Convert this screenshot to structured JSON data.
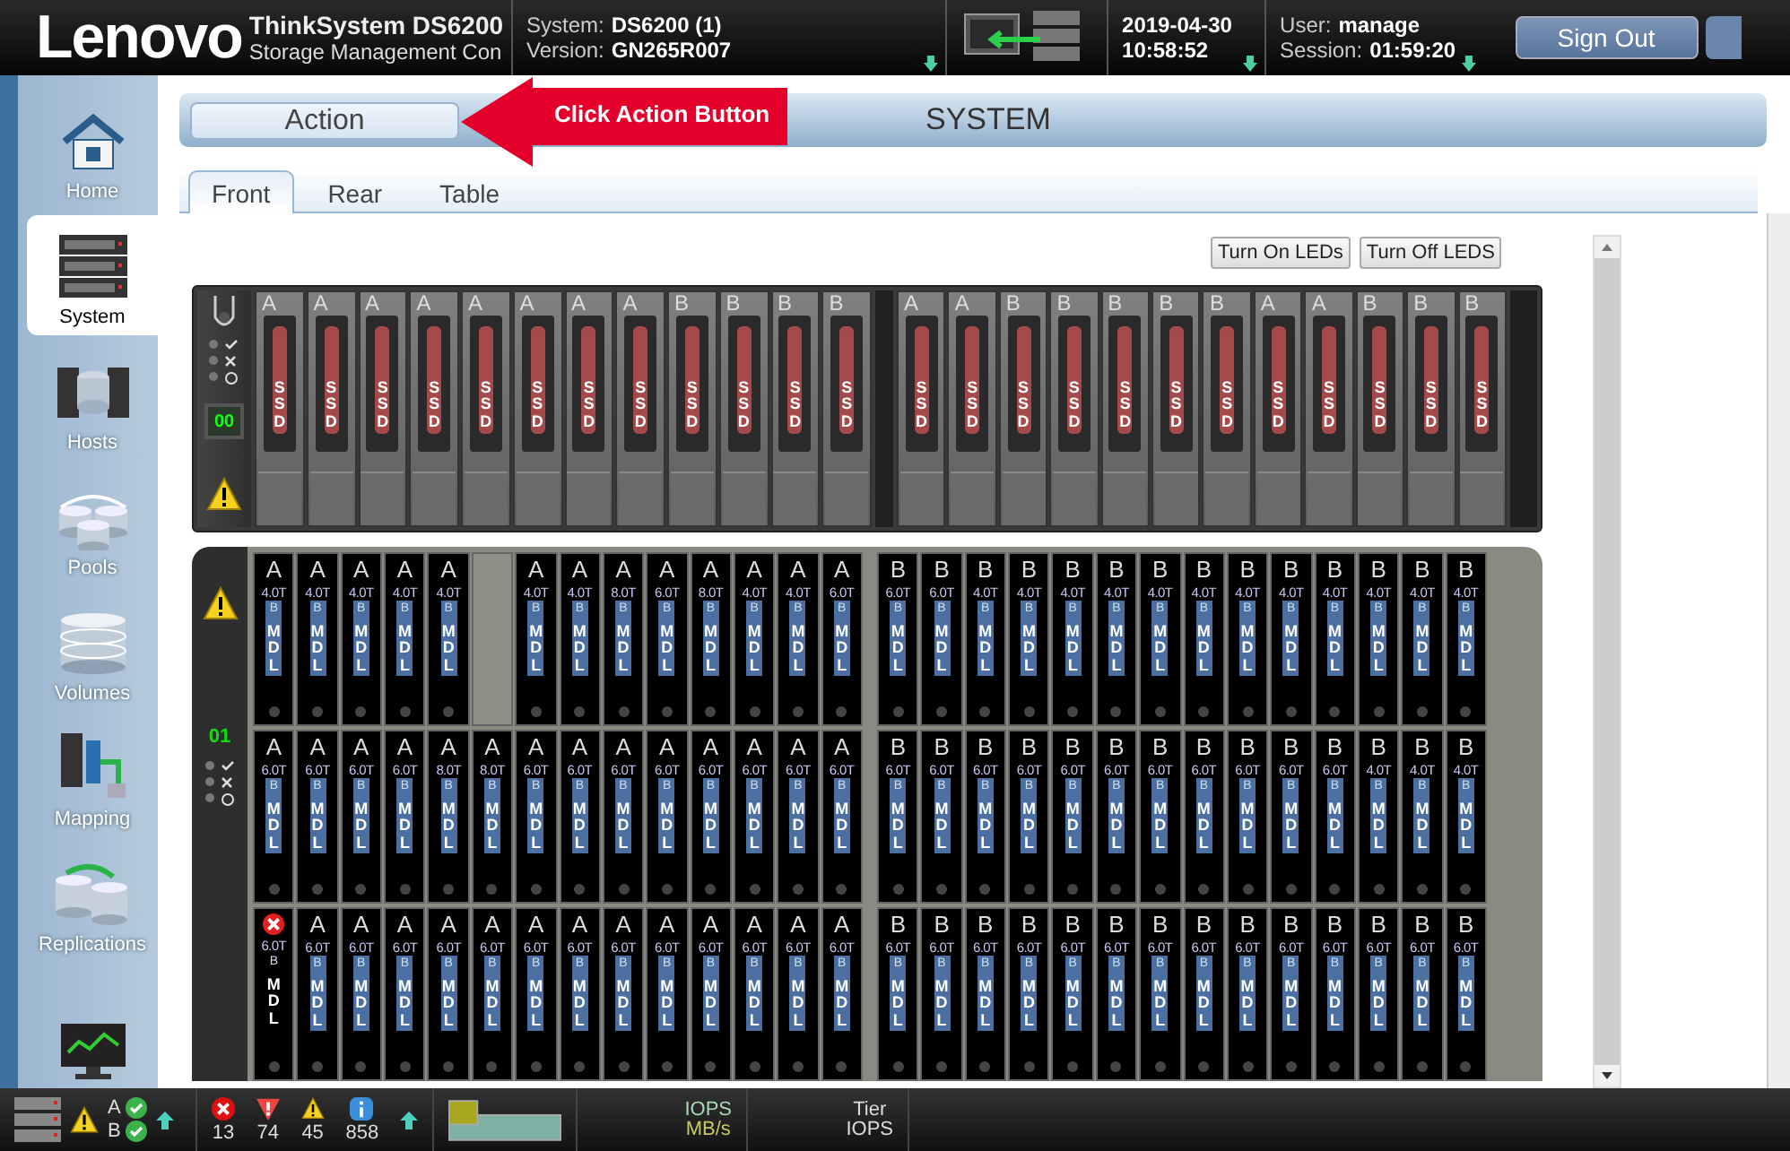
{
  "header": {
    "logo": "Lenovo",
    "product": "ThinkSystem DS6200",
    "subtitle": "Storage Management Con",
    "system_label": "System:",
    "system": "DS6200 (1)",
    "version_label": "Version:",
    "version": "GN265R007",
    "date": "2019-04-30",
    "time": "10:58:52",
    "user_label": "User:",
    "user": "manage",
    "session_label": "Session:",
    "session": "01:59:20",
    "sign_out": "Sign Out"
  },
  "sidebar": {
    "items": [
      {
        "label": "Home",
        "selected": false
      },
      {
        "label": "System",
        "selected": true
      },
      {
        "label": "Hosts",
        "selected": false
      },
      {
        "label": "Pools",
        "selected": false
      },
      {
        "label": "Volumes",
        "selected": false
      },
      {
        "label": "Mapping",
        "selected": false
      },
      {
        "label": "Replications",
        "selected": false
      }
    ]
  },
  "action_bar": {
    "button": "Action",
    "title": "SYSTEM",
    "callout": "Click Action Button"
  },
  "tabs": [
    {
      "label": "Front",
      "selected": true
    },
    {
      "label": "Rear",
      "selected": false
    },
    {
      "label": "Table",
      "selected": false
    }
  ],
  "led_buttons": [
    "Turn On LEDs",
    "Turn Off LEDS"
  ],
  "front_enclosure": {
    "display": "00",
    "left": [
      {
        "controller": "A",
        "type": "SSD"
      },
      {
        "controller": "A",
        "type": "SSD"
      },
      {
        "controller": "A",
        "type": "SSD"
      },
      {
        "controller": "A",
        "type": "SSD"
      },
      {
        "controller": "A",
        "type": "SSD"
      },
      {
        "controller": "A",
        "type": "SSD"
      },
      {
        "controller": "A",
        "type": "SSD"
      },
      {
        "controller": "A",
        "type": "SSD"
      },
      {
        "controller": "B",
        "type": "SSD"
      },
      {
        "controller": "B",
        "type": "SSD"
      },
      {
        "controller": "B",
        "type": "SSD"
      },
      {
        "controller": "B",
        "type": "SSD"
      }
    ],
    "right": [
      {
        "controller": "A",
        "type": "SSD"
      },
      {
        "controller": "A",
        "type": "SSD"
      },
      {
        "controller": "B",
        "type": "SSD"
      },
      {
        "controller": "B",
        "type": "SSD"
      },
      {
        "controller": "B",
        "type": "SSD"
      },
      {
        "controller": "B",
        "type": "SSD"
      },
      {
        "controller": "B",
        "type": "SSD"
      },
      {
        "controller": "A",
        "type": "SSD"
      },
      {
        "controller": "A",
        "type": "SSD"
      },
      {
        "controller": "B",
        "type": "SSD"
      },
      {
        "controller": "B",
        "type": "SSD"
      },
      {
        "controller": "B",
        "type": "SSD"
      }
    ]
  },
  "drive_enclosure": {
    "display": "01",
    "rows": [
      {
        "left": [
          {
            "kind": "drive",
            "controller": "A",
            "capacity": "4.0T",
            "tier": "B",
            "type": "MDL"
          },
          {
            "kind": "drive",
            "controller": "A",
            "capacity": "4.0T",
            "tier": "B",
            "type": "MDL"
          },
          {
            "kind": "drive",
            "controller": "A",
            "capacity": "4.0T",
            "tier": "B",
            "type": "MDL"
          },
          {
            "kind": "drive",
            "controller": "A",
            "capacity": "4.0T",
            "tier": "B",
            "type": "MDL"
          },
          {
            "kind": "drive",
            "controller": "A",
            "capacity": "4.0T",
            "tier": "B",
            "type": "MDL"
          },
          {
            "kind": "empty"
          },
          {
            "kind": "drive",
            "controller": "A",
            "capacity": "4.0T",
            "tier": "B",
            "type": "MDL"
          },
          {
            "kind": "drive",
            "controller": "A",
            "capacity": "4.0T",
            "tier": "B",
            "type": "MDL"
          },
          {
            "kind": "drive",
            "controller": "A",
            "capacity": "8.0T",
            "tier": "B",
            "type": "MDL"
          },
          {
            "kind": "drive",
            "controller": "A",
            "capacity": "6.0T",
            "tier": "B",
            "type": "MDL"
          },
          {
            "kind": "drive",
            "controller": "A",
            "capacity": "8.0T",
            "tier": "B",
            "type": "MDL"
          },
          {
            "kind": "drive",
            "controller": "A",
            "capacity": "4.0T",
            "tier": "B",
            "type": "MDL"
          },
          {
            "kind": "drive",
            "controller": "A",
            "capacity": "4.0T",
            "tier": "B",
            "type": "MDL"
          },
          {
            "kind": "drive",
            "controller": "A",
            "capacity": "6.0T",
            "tier": "B",
            "type": "MDL"
          }
        ],
        "right": [
          {
            "kind": "drive",
            "controller": "B",
            "capacity": "6.0T",
            "tier": "B",
            "type": "MDL"
          },
          {
            "kind": "drive",
            "controller": "B",
            "capacity": "6.0T",
            "tier": "B",
            "type": "MDL"
          },
          {
            "kind": "drive",
            "controller": "B",
            "capacity": "4.0T",
            "tier": "B",
            "type": "MDL"
          },
          {
            "kind": "drive",
            "controller": "B",
            "capacity": "4.0T",
            "tier": "B",
            "type": "MDL"
          },
          {
            "kind": "drive",
            "controller": "B",
            "capacity": "4.0T",
            "tier": "B",
            "type": "MDL"
          },
          {
            "kind": "drive",
            "controller": "B",
            "capacity": "4.0T",
            "tier": "B",
            "type": "MDL"
          },
          {
            "kind": "drive",
            "controller": "B",
            "capacity": "4.0T",
            "tier": "B",
            "type": "MDL"
          },
          {
            "kind": "drive",
            "controller": "B",
            "capacity": "4.0T",
            "tier": "B",
            "type": "MDL"
          },
          {
            "kind": "drive",
            "controller": "B",
            "capacity": "4.0T",
            "tier": "B",
            "type": "MDL"
          },
          {
            "kind": "drive",
            "controller": "B",
            "capacity": "4.0T",
            "tier": "B",
            "type": "MDL"
          },
          {
            "kind": "drive",
            "controller": "B",
            "capacity": "4.0T",
            "tier": "B",
            "type": "MDL"
          },
          {
            "kind": "drive",
            "controller": "B",
            "capacity": "4.0T",
            "tier": "B",
            "type": "MDL"
          },
          {
            "kind": "drive",
            "controller": "B",
            "capacity": "4.0T",
            "tier": "B",
            "type": "MDL"
          },
          {
            "kind": "drive",
            "controller": "B",
            "capacity": "4.0T",
            "tier": "B",
            "type": "MDL"
          }
        ]
      },
      {
        "left": [
          {
            "kind": "drive",
            "controller": "A",
            "capacity": "6.0T",
            "tier": "B",
            "type": "MDL"
          },
          {
            "kind": "drive",
            "controller": "A",
            "capacity": "6.0T",
            "tier": "B",
            "type": "MDL"
          },
          {
            "kind": "drive",
            "controller": "A",
            "capacity": "6.0T",
            "tier": "B",
            "type": "MDL"
          },
          {
            "kind": "drive",
            "controller": "A",
            "capacity": "6.0T",
            "tier": "B",
            "type": "MDL"
          },
          {
            "kind": "drive",
            "controller": "A",
            "capacity": "8.0T",
            "tier": "B",
            "type": "MDL"
          },
          {
            "kind": "drive",
            "controller": "A",
            "capacity": "8.0T",
            "tier": "B",
            "type": "MDL"
          },
          {
            "kind": "drive",
            "controller": "A",
            "capacity": "6.0T",
            "tier": "B",
            "type": "MDL"
          },
          {
            "kind": "drive",
            "controller": "A",
            "capacity": "6.0T",
            "tier": "B",
            "type": "MDL"
          },
          {
            "kind": "drive",
            "controller": "A",
            "capacity": "6.0T",
            "tier": "B",
            "type": "MDL"
          },
          {
            "kind": "drive",
            "controller": "A",
            "capacity": "6.0T",
            "tier": "B",
            "type": "MDL"
          },
          {
            "kind": "drive",
            "controller": "A",
            "capacity": "6.0T",
            "tier": "B",
            "type": "MDL"
          },
          {
            "kind": "drive",
            "controller": "A",
            "capacity": "6.0T",
            "tier": "B",
            "type": "MDL"
          },
          {
            "kind": "drive",
            "controller": "A",
            "capacity": "6.0T",
            "tier": "B",
            "type": "MDL"
          },
          {
            "kind": "drive",
            "controller": "A",
            "capacity": "6.0T",
            "tier": "B",
            "type": "MDL"
          }
        ],
        "right": [
          {
            "kind": "drive",
            "controller": "B",
            "capacity": "6.0T",
            "tier": "B",
            "type": "MDL"
          },
          {
            "kind": "drive",
            "controller": "B",
            "capacity": "6.0T",
            "tier": "B",
            "type": "MDL"
          },
          {
            "kind": "drive",
            "controller": "B",
            "capacity": "6.0T",
            "tier": "B",
            "type": "MDL"
          },
          {
            "kind": "drive",
            "controller": "B",
            "capacity": "6.0T",
            "tier": "B",
            "type": "MDL"
          },
          {
            "kind": "drive",
            "controller": "B",
            "capacity": "6.0T",
            "tier": "B",
            "type": "MDL"
          },
          {
            "kind": "drive",
            "controller": "B",
            "capacity": "6.0T",
            "tier": "B",
            "type": "MDL"
          },
          {
            "kind": "drive",
            "controller": "B",
            "capacity": "6.0T",
            "tier": "B",
            "type": "MDL"
          },
          {
            "kind": "drive",
            "controller": "B",
            "capacity": "6.0T",
            "tier": "B",
            "type": "MDL"
          },
          {
            "kind": "drive",
            "controller": "B",
            "capacity": "6.0T",
            "tier": "B",
            "type": "MDL"
          },
          {
            "kind": "drive",
            "controller": "B",
            "capacity": "6.0T",
            "tier": "B",
            "type": "MDL"
          },
          {
            "kind": "drive",
            "controller": "B",
            "capacity": "6.0T",
            "tier": "B",
            "type": "MDL"
          },
          {
            "kind": "drive",
            "controller": "B",
            "capacity": "4.0T",
            "tier": "B",
            "type": "MDL"
          },
          {
            "kind": "drive",
            "controller": "B",
            "capacity": "4.0T",
            "tier": "B",
            "type": "MDL"
          },
          {
            "kind": "drive",
            "controller": "B",
            "capacity": "4.0T",
            "tier": "B",
            "type": "MDL"
          }
        ]
      },
      {
        "left": [
          {
            "kind": "failed",
            "capacity": "6.0T",
            "tier": "B",
            "type": "MDL"
          },
          {
            "kind": "drive",
            "controller": "A",
            "capacity": "6.0T",
            "tier": "B",
            "type": "MDL"
          },
          {
            "kind": "drive",
            "controller": "A",
            "capacity": "6.0T",
            "tier": "B",
            "type": "MDL"
          },
          {
            "kind": "drive",
            "controller": "A",
            "capacity": "6.0T",
            "tier": "B",
            "type": "MDL"
          },
          {
            "kind": "drive",
            "controller": "A",
            "capacity": "6.0T",
            "tier": "B",
            "type": "MDL"
          },
          {
            "kind": "drive",
            "controller": "A",
            "capacity": "6.0T",
            "tier": "B",
            "type": "MDL"
          },
          {
            "kind": "drive",
            "controller": "A",
            "capacity": "6.0T",
            "tier": "B",
            "type": "MDL"
          },
          {
            "kind": "drive",
            "controller": "A",
            "capacity": "6.0T",
            "tier": "B",
            "type": "MDL"
          },
          {
            "kind": "drive",
            "controller": "A",
            "capacity": "6.0T",
            "tier": "B",
            "type": "MDL"
          },
          {
            "kind": "drive",
            "controller": "A",
            "capacity": "6.0T",
            "tier": "B",
            "type": "MDL"
          },
          {
            "kind": "drive",
            "controller": "A",
            "capacity": "6.0T",
            "tier": "B",
            "type": "MDL"
          },
          {
            "kind": "drive",
            "controller": "A",
            "capacity": "6.0T",
            "tier": "B",
            "type": "MDL"
          },
          {
            "kind": "drive",
            "controller": "A",
            "capacity": "6.0T",
            "tier": "B",
            "type": "MDL"
          },
          {
            "kind": "drive",
            "controller": "A",
            "capacity": "6.0T",
            "tier": "B",
            "type": "MDL"
          }
        ],
        "right": [
          {
            "kind": "drive",
            "controller": "B",
            "capacity": "6.0T",
            "tier": "B",
            "type": "MDL"
          },
          {
            "kind": "drive",
            "controller": "B",
            "capacity": "6.0T",
            "tier": "B",
            "type": "MDL"
          },
          {
            "kind": "drive",
            "controller": "B",
            "capacity": "6.0T",
            "tier": "B",
            "type": "MDL"
          },
          {
            "kind": "drive",
            "controller": "B",
            "capacity": "6.0T",
            "tier": "B",
            "type": "MDL"
          },
          {
            "kind": "drive",
            "controller": "B",
            "capacity": "6.0T",
            "tier": "B",
            "type": "MDL"
          },
          {
            "kind": "drive",
            "controller": "B",
            "capacity": "6.0T",
            "tier": "B",
            "type": "MDL"
          },
          {
            "kind": "drive",
            "controller": "B",
            "capacity": "6.0T",
            "tier": "B",
            "type": "MDL"
          },
          {
            "kind": "drive",
            "controller": "B",
            "capacity": "6.0T",
            "tier": "B",
            "type": "MDL"
          },
          {
            "kind": "drive",
            "controller": "B",
            "capacity": "6.0T",
            "tier": "B",
            "type": "MDL"
          },
          {
            "kind": "drive",
            "controller": "B",
            "capacity": "6.0T",
            "tier": "B",
            "type": "MDL"
          },
          {
            "kind": "drive",
            "controller": "B",
            "capacity": "6.0T",
            "tier": "B",
            "type": "MDL"
          },
          {
            "kind": "drive",
            "controller": "B",
            "capacity": "6.0T",
            "tier": "B",
            "type": "MDL"
          },
          {
            "kind": "drive",
            "controller": "B",
            "capacity": "6.0T",
            "tier": "B",
            "type": "MDL"
          },
          {
            "kind": "drive",
            "controller": "B",
            "capacity": "6.0T",
            "tier": "B",
            "type": "MDL"
          }
        ]
      }
    ]
  },
  "status_bar": {
    "controllers": [
      {
        "name": "A"
      },
      {
        "name": "B"
      }
    ],
    "alerts": [
      {
        "kind": "critical",
        "count": "13"
      },
      {
        "kind": "error",
        "count": "74"
      },
      {
        "kind": "warning",
        "count": "45"
      },
      {
        "kind": "info",
        "count": "858"
      }
    ],
    "metrics": [
      {
        "line1": "IOPS",
        "line2": "MB/s"
      },
      {
        "line1": "Tier",
        "line2": "IOPS"
      }
    ]
  }
}
